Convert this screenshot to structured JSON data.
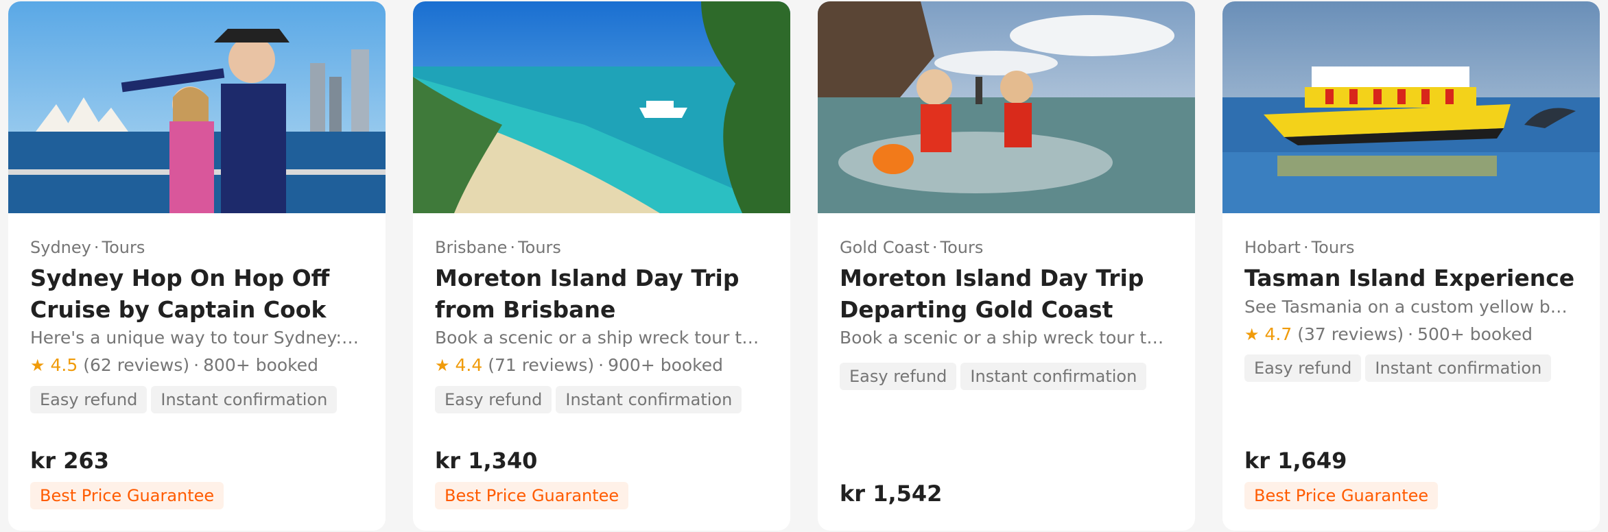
{
  "colors": {
    "accent_orange": "#ff5b00",
    "star": "#f09b0a",
    "badge_bg": "#fff1e8",
    "tag_bg": "#f2f2f2",
    "muted_text": "#757575",
    "title_text": "#212121"
  },
  "cards": [
    {
      "image_alt": "Captain Cook costumed guide with a girl in front of Sydney Opera House",
      "city": "Sydney",
      "category": "Tours",
      "title": "Sydney Hop On Hop Off Cruise by Captain Cook",
      "description": "Here's a unique way to tour Sydney: by…",
      "rating": "4.5",
      "reviews": "(62 reviews)",
      "booked": "800+ booked",
      "tags": [
        "Easy refund",
        "Instant confirmation"
      ],
      "price": "kr 263",
      "badge": "Best Price Guarantee"
    },
    {
      "image_alt": "Sandy beach on Moreton Island with a ferry in turquoise water",
      "city": "Brisbane",
      "category": "Tours",
      "title": "Moreton Island Day Trip from Brisbane",
      "description": "Book a scenic or a ship wreck tour to…",
      "rating": "4.4",
      "reviews": "(71 reviews)",
      "booked": "900+ booked",
      "tags": [
        "Easy refund",
        "Instant confirmation"
      ],
      "price": "kr 1,340",
      "badge": "Best Price Guarantee"
    },
    {
      "image_alt": "Two women in a clear kayak near shipwrecks",
      "city": "Gold Coast",
      "category": "Tours",
      "title": "Moreton Island Day Trip Departing Gold Coast",
      "description": "Book a scenic or a ship wreck tour to…",
      "tags": [
        "Easy refund",
        "Instant confirmation"
      ],
      "price": "kr 1,542"
    },
    {
      "image_alt": "Yellow tour boat with passengers in red jackets and a dolphin",
      "city": "Hobart",
      "category": "Tours",
      "title": "Tasman Island Experience",
      "description": "See Tasmania on a custom yellow boa…",
      "rating": "4.7",
      "reviews": "(37 reviews)",
      "booked": "500+ booked",
      "tags": [
        "Easy refund",
        "Instant confirmation"
      ],
      "price": "kr 1,649",
      "badge": "Best Price Guarantee"
    }
  ]
}
